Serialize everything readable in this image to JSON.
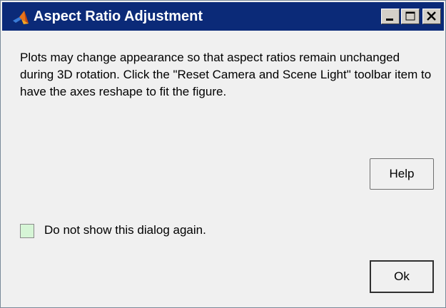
{
  "window": {
    "title": "Aspect Ratio Adjustment",
    "icon": "matlab-logo-icon",
    "controls": [
      "minimize-icon",
      "maximize-icon",
      "close-icon"
    ]
  },
  "dialog": {
    "message": "Plots may change appearance so that aspect ratios remain unchanged during 3D rotation. Click the \"Reset Camera and Scene Light\" toolbar item to have the axes reshape to fit the figure.",
    "help_label": "Help",
    "checkbox_label": "Do not show this dialog again.",
    "checkbox_checked": false,
    "ok_label": "Ok"
  },
  "colors": {
    "titlebar": "#0b2a78",
    "background": "#f0f0f0",
    "checkbox_fill": "#d6f5d6"
  }
}
